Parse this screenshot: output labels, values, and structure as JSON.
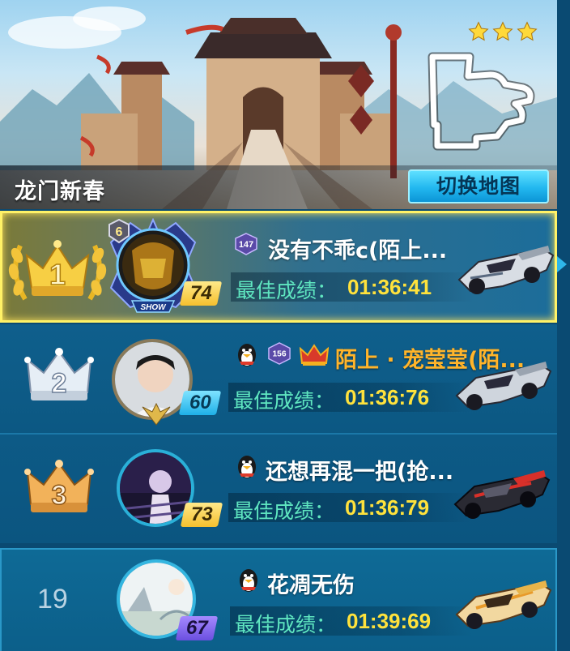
{
  "map": {
    "title": "龙门新春",
    "switch_label": "切换地图",
    "stars": 3
  },
  "leaderboard": [
    {
      "rank": 1,
      "rank_display": "1",
      "medal": "gold-crown-laurel",
      "avatar_rank_badge": "6",
      "avatar_frame_text": "SHOW",
      "level": "74",
      "vip_level": "147",
      "name": "没有不乖c(陌上...",
      "best_label": "最佳成绩：",
      "best_time": "01:36:41",
      "highlighted": true
    },
    {
      "rank": 2,
      "rank_display": "2",
      "medal": "silver-crown",
      "level": "60",
      "vip_level": "156",
      "has_qq_icon": true,
      "has_crown_icon": true,
      "name": "陌上 · 宠莹莹(陌...",
      "best_label": "最佳成绩：",
      "best_time": "01:36:76"
    },
    {
      "rank": 3,
      "rank_display": "3",
      "medal": "bronze-crown",
      "level": "73",
      "has_qq_icon": true,
      "name": "还想再混一把(抢...",
      "best_label": "最佳成绩：",
      "best_time": "01:36:79"
    },
    {
      "rank": 19,
      "rank_display": "19",
      "level": "67",
      "has_qq_icon": true,
      "name": "花凋无伤",
      "best_label": "最佳成绩：",
      "best_time": "01:39:69",
      "is_self": true
    }
  ],
  "colors": {
    "gold": "#ffe23c",
    "label_teal": "#5fe6c0",
    "highlight_border": "#fff267",
    "button": "#22b7ef",
    "panel": "#0c5883"
  }
}
